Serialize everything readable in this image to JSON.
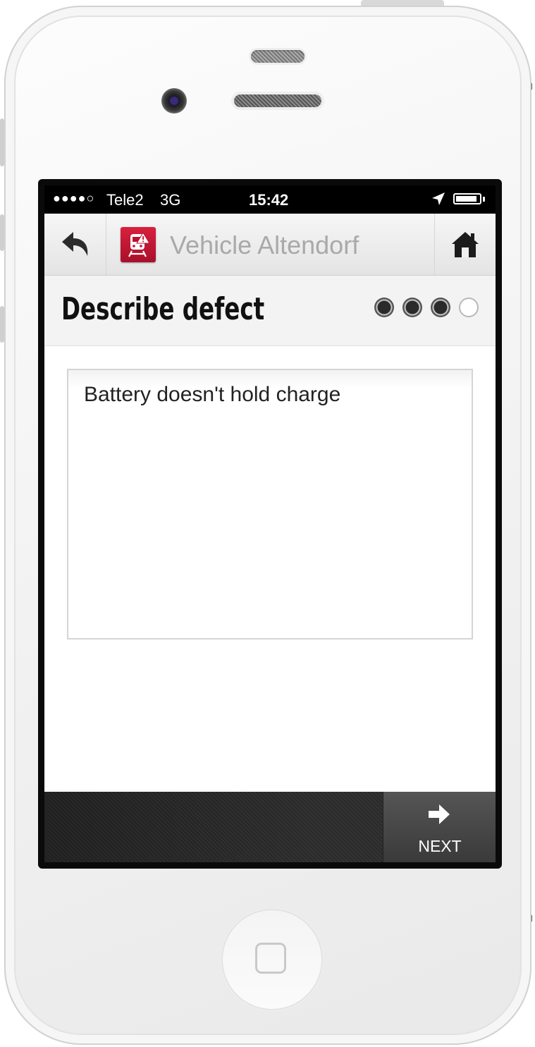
{
  "statusbar": {
    "signal": "●●●●○",
    "carrier": "Tele2",
    "network": "3G",
    "time": "15:42",
    "battery_level": 0.9
  },
  "navbar": {
    "title": "Vehicle Altendorf",
    "back_icon": "back-arrow-icon",
    "home_icon": "home-icon",
    "app_icon": "train-warning-icon"
  },
  "step": {
    "title": "Describe defect",
    "total_steps": 4,
    "current_step": 3
  },
  "form": {
    "description_value": "Battery doesn't hold charge"
  },
  "toolbar": {
    "next_label": "NEXT",
    "next_icon": "arrow-right-icon"
  },
  "colors": {
    "accent": "#c8163a",
    "toolbar": "#2e2e2e",
    "title_muted": "#a9a9a9"
  }
}
